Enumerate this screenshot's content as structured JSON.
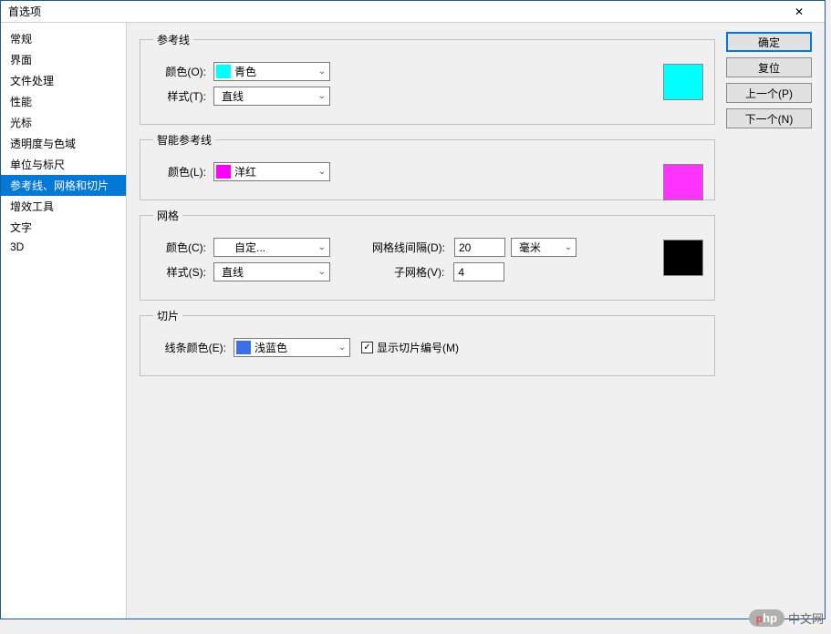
{
  "title": "首选项",
  "sidebar": {
    "items": [
      {
        "label": "常规"
      },
      {
        "label": "界面"
      },
      {
        "label": "文件处理"
      },
      {
        "label": "性能"
      },
      {
        "label": "光标"
      },
      {
        "label": "透明度与色域"
      },
      {
        "label": "单位与标尺"
      },
      {
        "label": "参考线、网格和切片",
        "selected": true
      },
      {
        "label": "增效工具"
      },
      {
        "label": "文字"
      },
      {
        "label": "3D"
      }
    ]
  },
  "buttons": {
    "ok": "确定",
    "reset": "复位",
    "prev": "上一个(P)",
    "next": "下一个(N)"
  },
  "guides": {
    "legend": "参考线",
    "color_label": "颜色(O):",
    "color_value": "青色",
    "color_hex": "#00ffff",
    "style_label": "样式(T):",
    "style_value": "直线",
    "swatch": "#00ffff"
  },
  "smart_guides": {
    "legend": "智能参考线",
    "color_label": "颜色(L):",
    "color_value": "洋红",
    "color_hex": "#ff00ff",
    "swatch": "#ff33ff"
  },
  "grid": {
    "legend": "网格",
    "color_label": "颜色(C):",
    "color_value": "自定...",
    "color_hex": "#ffffff",
    "style_label": "样式(S):",
    "style_value": "直线",
    "spacing_label": "网格线间隔(D):",
    "spacing_value": "20",
    "unit_value": "毫米",
    "sub_label": "子网格(V):",
    "sub_value": "4",
    "swatch": "#000000"
  },
  "slices": {
    "legend": "切片",
    "color_label": "线条颜色(E):",
    "color_value": "浅蓝色",
    "color_hex": "#3b6fe8",
    "show_numbers_label": "显示切片编号(M)",
    "show_numbers_checked": true
  },
  "watermark": {
    "badge_prefix": "php",
    "text": "中文网"
  }
}
